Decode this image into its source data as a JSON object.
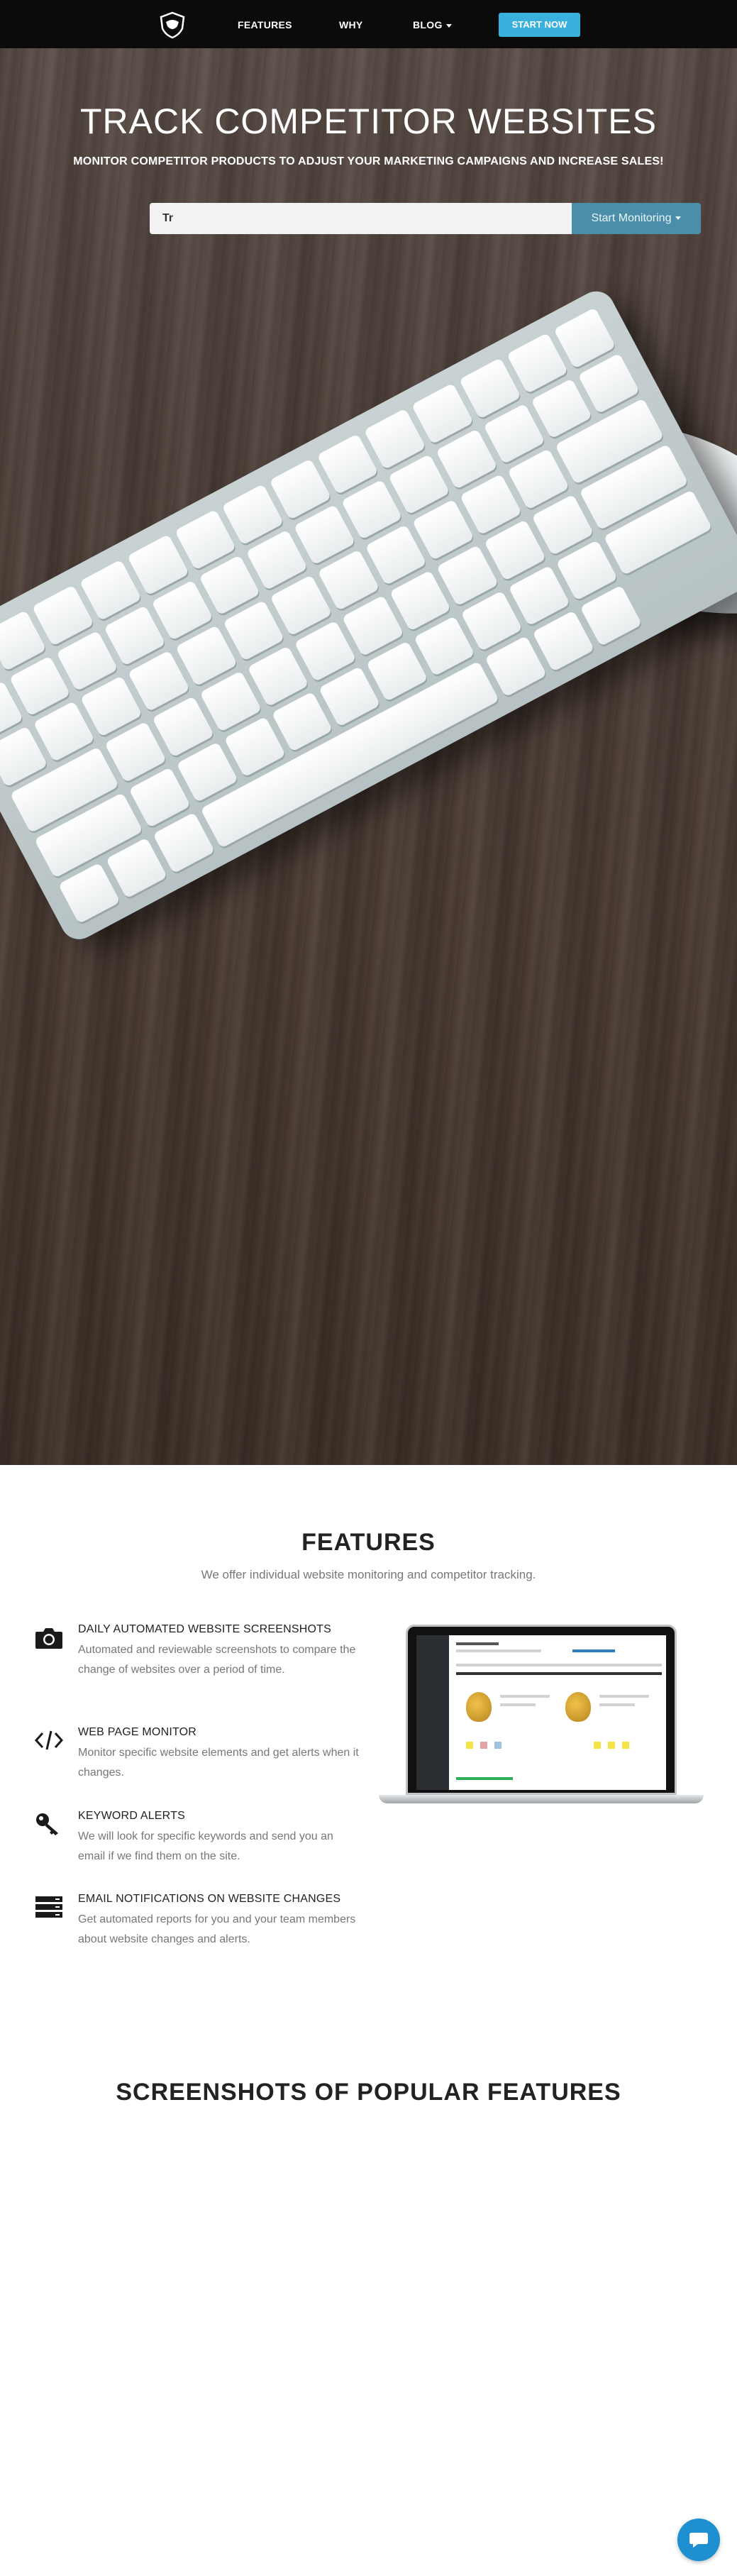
{
  "nav": {
    "items": [
      {
        "label": "FEATURES"
      },
      {
        "label": "WHY"
      },
      {
        "label": "BLOG"
      }
    ],
    "cta_label": "START NOW"
  },
  "hero": {
    "title": "TRACK COMPETITOR WEBSITES",
    "subtitle": "MONITOR COMPETITOR PRODUCTS TO ADJUST YOUR MARKETING CAMPAIGNS AND INCREASE SALES!",
    "search_value": "Tr",
    "search_button": "Start Monitoring"
  },
  "features": {
    "title": "FEATURES",
    "subtitle": "We offer individual website monitoring and competitor tracking.",
    "items": [
      {
        "icon": "camera-icon",
        "heading": "DAILY AUTOMATED WEBSITE SCREENSHOTS",
        "body": "Automated and reviewable screenshots to compare the change of websites over a period of time."
      },
      {
        "icon": "code-icon",
        "heading": "WEB PAGE MONITOR",
        "body": "Monitor specific website elements and get alerts when it changes."
      },
      {
        "icon": "key-icon",
        "heading": "KEYWORD ALERTS",
        "body": "We will look for specific keywords and send you an email if we find them on the site."
      },
      {
        "icon": "server-icon",
        "heading": "EMAIL NOTIFICATIONS ON WEBSITE CHANGES",
        "body": "Get automated reports for you and your team members about website changes and alerts."
      }
    ]
  },
  "screenshots": {
    "title": "SCREENSHOTS OF POPULAR FEATURES"
  },
  "chat": {
    "icon": "chat-bubble-icon"
  }
}
